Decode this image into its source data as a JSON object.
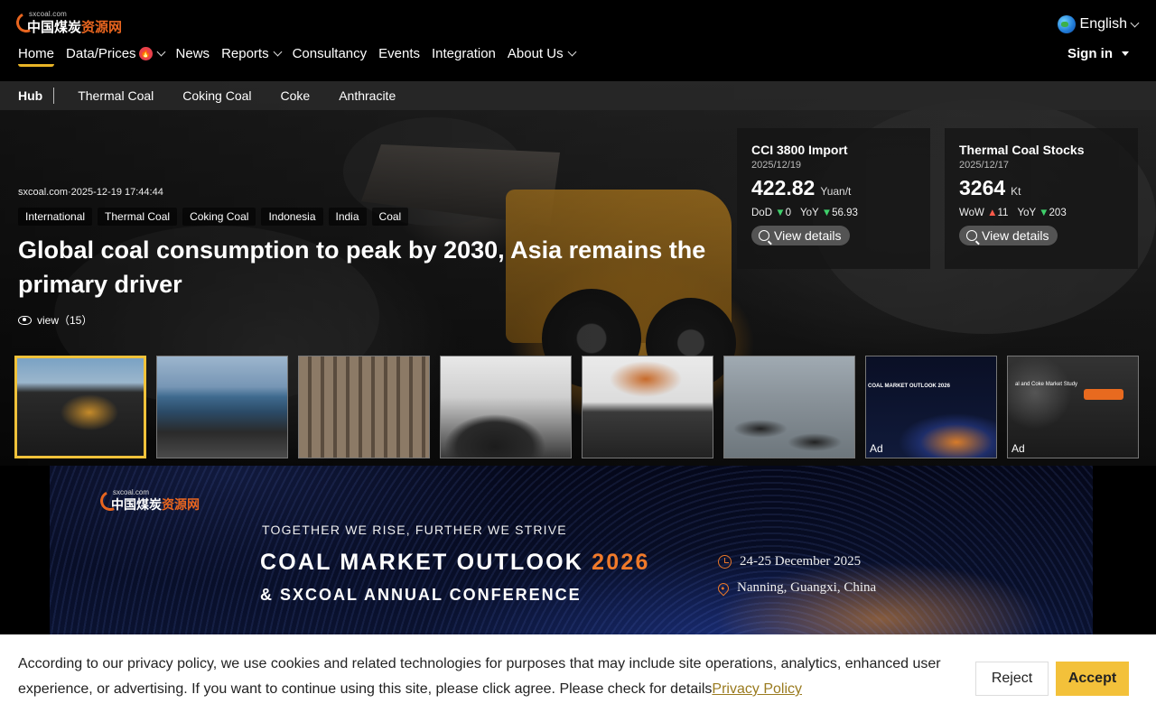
{
  "header": {
    "logo": {
      "small": "sxcoal.com",
      "main_white": "中国煤炭",
      "main_orange": "资源网"
    },
    "language": "English",
    "nav": [
      {
        "label": "Home",
        "active": true,
        "dropdown": false,
        "hot": false
      },
      {
        "label": "Data/Prices",
        "active": false,
        "dropdown": true,
        "hot": true
      },
      {
        "label": "News",
        "active": false,
        "dropdown": false,
        "hot": false
      },
      {
        "label": "Reports",
        "active": false,
        "dropdown": true,
        "hot": false
      },
      {
        "label": "Consultancy",
        "active": false,
        "dropdown": false,
        "hot": false
      },
      {
        "label": "Events",
        "active": false,
        "dropdown": false,
        "hot": false
      },
      {
        "label": "Integration",
        "active": false,
        "dropdown": false,
        "hot": false
      },
      {
        "label": "About Us",
        "active": false,
        "dropdown": true,
        "hot": false
      }
    ],
    "signin": "Sign in"
  },
  "subnav": {
    "hub": "Hub",
    "items": [
      "Thermal Coal",
      "Coking Coal",
      "Coke",
      "Anthracite"
    ]
  },
  "hero": {
    "meta": "sxcoal.com·2025-12-19 17:44:44",
    "tags": [
      "International",
      "Thermal Coal",
      "Coking Coal",
      "Indonesia",
      "India",
      "Coal"
    ],
    "headline": "Global coal consumption to peak by 2030, Asia remains the primary driver",
    "views": "view（15）"
  },
  "cards": [
    {
      "title": "CCI 3800 Import",
      "date": "2025/12/19",
      "value": "422.82",
      "unit": "Yuan/t",
      "change1_label": "DoD",
      "change1_dir": "down",
      "change1_value": "0",
      "change2_label": "YoY",
      "change2_dir": "down",
      "change2_value": "56.93",
      "button": "View details"
    },
    {
      "title": "Thermal Coal Stocks",
      "date": "2025/12/17",
      "value": "3264",
      "unit": "Kt",
      "change1_label": "WoW",
      "change1_dir": "up",
      "change1_value": "11",
      "change2_label": "YoY",
      "change2_dir": "down",
      "change2_value": "203",
      "button": "View details"
    }
  ],
  "thumbnails": {
    "ad_label": "Ad",
    "ad1_title": "COAL MARKET OUTLOOK 2026",
    "ad2_title": "al and Coke Market Study"
  },
  "banner": {
    "logo": {
      "small": "sxcoal.com",
      "main_white": "中国煤炭",
      "main_orange": "资源网"
    },
    "tagline": "TOGETHER WE RISE, FURTHER WE STRIVE",
    "title_main": "COAL MARKET OUTLOOK ",
    "title_year": "2026",
    "subtitle": "& SXCOAL ANNUAL CONFERENCE",
    "date": "24-25 December 2025",
    "location": "Nanning, Guangxi, China"
  },
  "cookie": {
    "text": "According to our privacy policy, we use cookies and related technologies for purposes that may include site operations, analytics, enhanced user experience, or advertising. If you want to continue using this site, please click agree. Please check for details",
    "link": "Privacy Policy",
    "reject": "Reject",
    "accept": "Accept"
  },
  "colors": {
    "accent": "#f3c13a",
    "brand_orange": "#e8651f",
    "up": "#ff5b4a",
    "down": "#3fd06b"
  }
}
